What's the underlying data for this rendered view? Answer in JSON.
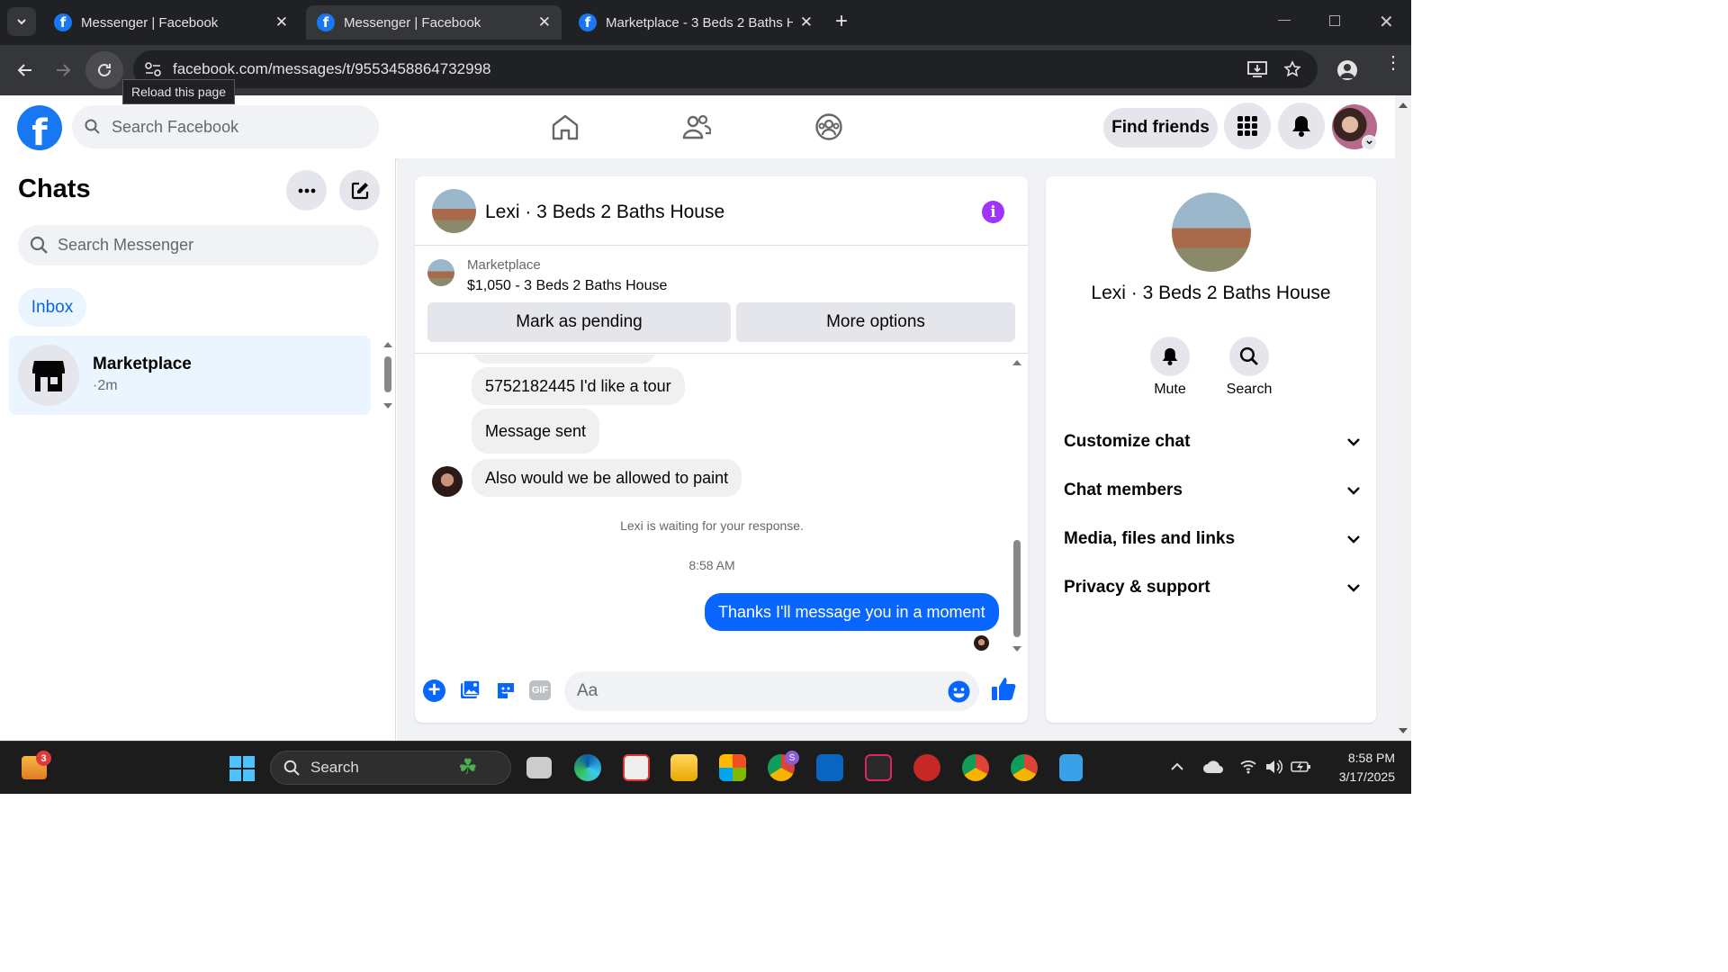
{
  "browser": {
    "tabs": [
      {
        "title": "Messenger | Facebook",
        "active": false
      },
      {
        "title": "Messenger | Facebook",
        "active": true
      },
      {
        "title": "Marketplace - 3 Beds 2 Baths H",
        "active": false
      }
    ],
    "url": "facebook.com/messages/t/9553458864732998",
    "tooltip": "Reload this page"
  },
  "fb_header": {
    "search_placeholder": "Search Facebook",
    "find_friends": "Find friends"
  },
  "left_panel": {
    "title": "Chats",
    "search_placeholder": "Search Messenger",
    "inbox_label": "Inbox",
    "conversations": [
      {
        "name": "Marketplace",
        "time": "·2m"
      }
    ]
  },
  "chat": {
    "title": "Lexi · 3 Beds 2 Baths House",
    "listing": {
      "category": "Marketplace",
      "summary": "$1,050 - 3 Beds 2 Baths House"
    },
    "mark_pending": "Mark as pending",
    "more_options": "More options",
    "messages": [
      {
        "text": "5752182445 I'd like a tour",
        "from": "them"
      },
      {
        "text": "Message sent",
        "from": "them"
      },
      {
        "text": "Also would we be allowed to paint",
        "from": "them"
      },
      {
        "text": "Thanks I'll message you in a moment",
        "from": "me"
      }
    ],
    "waiting_notice": "Lexi is waiting for your response.",
    "timestamp": "8:58 AM",
    "composer_placeholder": "Aa"
  },
  "info_panel": {
    "title": "Lexi · 3 Beds 2 Baths House",
    "mute": "Mute",
    "search": "Search",
    "sections": [
      "Customize chat",
      "Chat members",
      "Media, files and links",
      "Privacy & support"
    ]
  },
  "taskbar": {
    "search": "Search",
    "time": "8:58 PM",
    "date": "3/17/2025",
    "widget_badge": "3",
    "chrome_badge": "S"
  },
  "colors": {
    "fb_blue": "#1877f2",
    "purple": "#a033ff",
    "chrome_dark": "#202124"
  }
}
